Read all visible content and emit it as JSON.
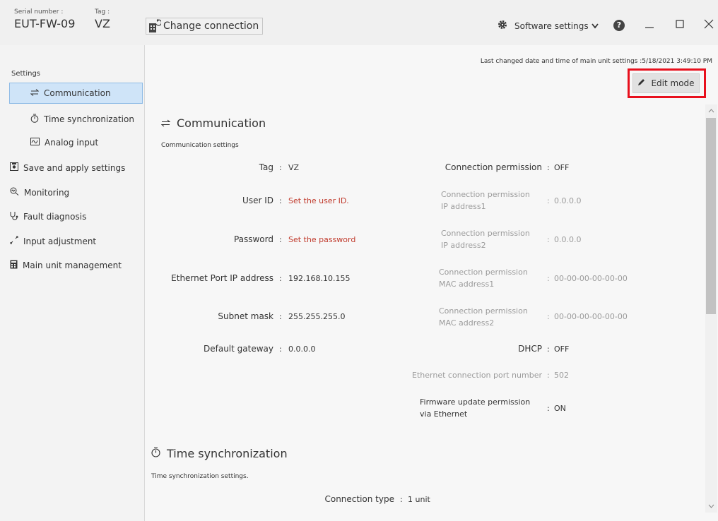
{
  "header": {
    "serial_label": "Serial number :",
    "serial_value": "EUT-FW-09",
    "tag_label": "Tag :",
    "tag_value": "VZ",
    "change_connection": "Change connection",
    "software_settings": "Software settings",
    "help_icon": "?"
  },
  "sidebar": {
    "heading": "Settings",
    "items": [
      {
        "label": "Communication",
        "icon": "transfer-arrows-icon",
        "selected": true
      },
      {
        "label": "Time synchronization",
        "icon": "stopwatch-icon"
      },
      {
        "label": "Analog input",
        "icon": "waveform-icon"
      },
      {
        "label": "Save and apply settings",
        "icon": "save-icon"
      },
      {
        "label": "Monitoring",
        "icon": "monitor-search-icon"
      },
      {
        "label": "Fault diagnosis",
        "icon": "stethoscope-icon"
      },
      {
        "label": "Input adjustment",
        "icon": "adjust-arrows-icon"
      },
      {
        "label": "Main unit management",
        "icon": "device-icon"
      }
    ]
  },
  "main": {
    "last_changed": "Last changed date and time of main unit settings :5/18/2021 3:49:10 PM",
    "edit_mode": "Edit mode",
    "communication": {
      "title": "Communication",
      "subtitle": "Communication settings",
      "left": [
        {
          "label": "Tag",
          "value": "VZ",
          "style": "normal"
        },
        {
          "label": "User ID",
          "value": "Set the user ID.",
          "style": "red"
        },
        {
          "label": "Password",
          "value": "Set the password",
          "style": "red"
        },
        {
          "label": "Ethernet Port IP address",
          "value": "192.168.10.155",
          "style": "normal"
        },
        {
          "label": "Subnet mask",
          "value": "255.255.255.0",
          "style": "normal"
        },
        {
          "label": "Default gateway",
          "value": "0.0.0.0",
          "style": "normal"
        }
      ],
      "right": [
        {
          "label": "Connection permission",
          "value": "OFF"
        },
        {
          "label1": "Connection permission",
          "label2": "IP address1",
          "value": "0.0.0.0"
        },
        {
          "label1": "Connection permission",
          "label2": "IP address2",
          "value": "0.0.0.0"
        },
        {
          "label1": "Connection permission",
          "label2": "MAC address1",
          "value": "00-00-00-00-00-00"
        },
        {
          "label1": "Connection permission",
          "label2": "MAC address2",
          "value": "00-00-00-00-00-00"
        },
        {
          "label": "DHCP",
          "value": "OFF"
        },
        {
          "label": "Ethernet connection port number",
          "value": "502"
        },
        {
          "label1": "Firmware update permission",
          "label2": "via Ethernet",
          "value": "ON"
        }
      ]
    },
    "time_sync": {
      "title": "Time synchronization",
      "subtitle": "Time synchronization settings.",
      "connection_type_label": "Connection type",
      "connection_type_value": "1 unit"
    }
  },
  "colors": {
    "accent": "#cfe4f8",
    "highlight": "#e8101d",
    "required": "#c0392b"
  }
}
